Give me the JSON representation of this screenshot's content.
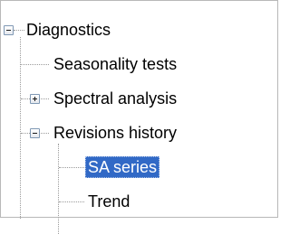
{
  "tree": {
    "root": {
      "label": "Diagnostics",
      "expanded": true,
      "expander_icon": "minus-box-icon"
    },
    "children": [
      {
        "label": "Seasonality tests",
        "type": "leaf"
      },
      {
        "label": "Spectral analysis",
        "type": "collapsed",
        "expander_icon": "plus-box-icon"
      },
      {
        "label": "Revisions history",
        "type": "expanded",
        "expander_icon": "minus-box-icon",
        "children": [
          {
            "label": "SA series",
            "selected": true
          },
          {
            "label": "Trend",
            "selected": false
          }
        ]
      }
    ]
  },
  "colors": {
    "selection_background": "#3169c6",
    "selection_text": "#ffffff",
    "connector": "#9a9a9a",
    "frame_border": "#b8b8b8"
  }
}
